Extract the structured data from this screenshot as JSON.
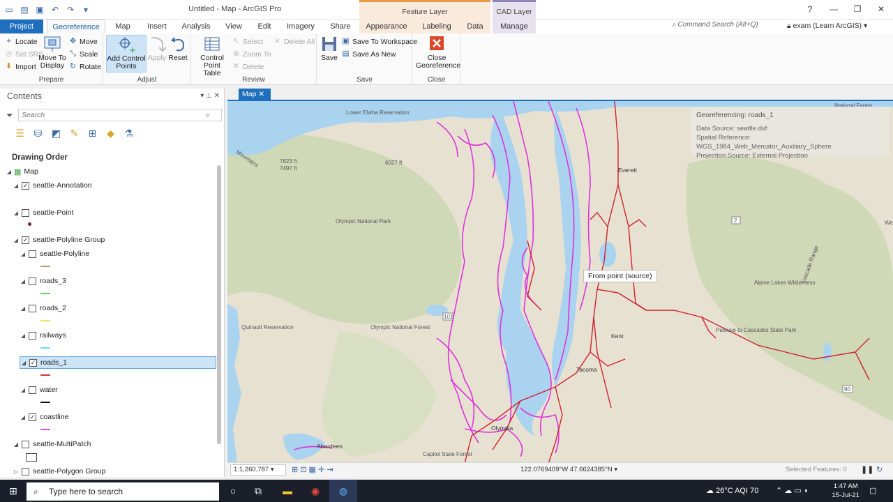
{
  "window": {
    "title": "Untitled - Map - ArcGIS Pro",
    "context_feature": "Feature Layer",
    "context_cad": "CAD Layer",
    "controls": [
      "?",
      "—",
      "❐",
      "✕"
    ]
  },
  "tabs": [
    "Project",
    "Georeference",
    "Map",
    "Insert",
    "Analysis",
    "View",
    "Edit",
    "Imagery",
    "Share",
    "Appearance",
    "Labeling",
    "Data",
    "Manage"
  ],
  "command_search": "Command Search (Alt+Q)",
  "user": "exam (Learn ArcGIS)",
  "ribbon": {
    "prepare": {
      "label": "Prepare",
      "locate": "Locate",
      "set_srs": "Set SRS",
      "import": "Import",
      "move_to_display": "Move To Display",
      "move": "Move",
      "scale": "Scale",
      "rotate": "Rotate"
    },
    "adjust": {
      "label": "Adjust",
      "add_control_points": "Add Control Points",
      "apply": "Apply",
      "reset": "Reset"
    },
    "review": {
      "label": "Review",
      "control_point_table": "Control Point Table",
      "select": "Select",
      "zoom_to": "Zoom To",
      "delete": "Delete",
      "delete_all": "Delete All"
    },
    "save": {
      "label": "Save",
      "save": "Save",
      "save_to_workspace": "Save To Workspace",
      "save_as_new": "Save As New"
    },
    "close": {
      "label": "Close",
      "close_georeference": "Close Georeference"
    }
  },
  "contents": {
    "title": "Contents",
    "search_placeholder": "Search",
    "drawing_order": "Drawing Order",
    "layers": [
      {
        "name": "Map",
        "indent": 0,
        "checked": false,
        "map": true
      },
      {
        "name": "seattle-Annotation",
        "indent": 1,
        "checked": true
      },
      {
        "name": "seattle-Point",
        "indent": 1,
        "checked": false
      },
      {
        "name": "seattle-Polyline Group",
        "indent": 1,
        "checked": true
      },
      {
        "name": "seattle-Polyline",
        "indent": 2,
        "checked": false
      },
      {
        "name": "roads_3",
        "indent": 2,
        "checked": false
      },
      {
        "name": "roads_2",
        "indent": 2,
        "checked": false
      },
      {
        "name": "railways",
        "indent": 2,
        "checked": false
      },
      {
        "name": "roads_1",
        "indent": 2,
        "checked": true,
        "selected": true
      },
      {
        "name": "water",
        "indent": 2,
        "checked": false
      },
      {
        "name": "coastline",
        "indent": 2,
        "checked": true
      },
      {
        "name": "seattle-MultiPatch",
        "indent": 1,
        "checked": false
      },
      {
        "name": "seattle-Polygon Group",
        "indent": 1,
        "checked": false
      }
    ],
    "symbol_colors": {
      "point": "#7a1f3d",
      "polyline": "#b59a6a",
      "roads_3": "#55d455",
      "roads_2": "#f2e14c",
      "railways": "#6fd9f2",
      "roads_1": "#d8323a",
      "water": "#111111",
      "coastline": "#e04ae0"
    }
  },
  "map": {
    "tab": "Map",
    "info": {
      "title": "Georeferencing: roads_1",
      "source": "Data Source: seattle.dxf",
      "spatial_ref": "Spatial Reference: WGS_1984_Web_Mercator_Auxiliary_Sphere",
      "projection": "Projection Source: External Projection"
    },
    "tooltip": "From point (source)",
    "labels": {
      "lower_elwha": "Lower Elwha Reservation",
      "mountains": "Mountains",
      "elev1": "7623 ft",
      "elev2": "7497 ft",
      "elev3": "6027 ft",
      "olympic_np": "Olympic National Park",
      "everett": "Everett",
      "quinault": "Quinault Reservation",
      "olympic_nf": "Olympic National Forest",
      "kent": "Kent",
      "tacoma": "Tacoma",
      "olympia": "Olympia",
      "aberdeen": "Aberdeen",
      "capitol": "Capitol State Forest",
      "alpine": "Alpine Lakes Wilderness",
      "cascade": "Cascade Range",
      "palouse": "Palouse to Cascades State Park",
      "natforest": "National Forest",
      "wena": "Wena",
      "hwy2": "2",
      "hwy101": "101",
      "hwy90": "90"
    },
    "colors": {
      "water": "#aad3f0",
      "land": "#e7e1d1",
      "green": "#c9d8b4",
      "coastline": "#dd33dd",
      "roads": "#d0202e"
    }
  },
  "status": {
    "scale": "1:1,260,787",
    "coords": "122.0769409°W 47.6624385°N",
    "selected": "Selected Features: 0"
  },
  "taskbar": {
    "search": "Type here to search",
    "weather": "26°C AQI 70",
    "time": "1:47 AM",
    "date": "15-Jul-21"
  }
}
